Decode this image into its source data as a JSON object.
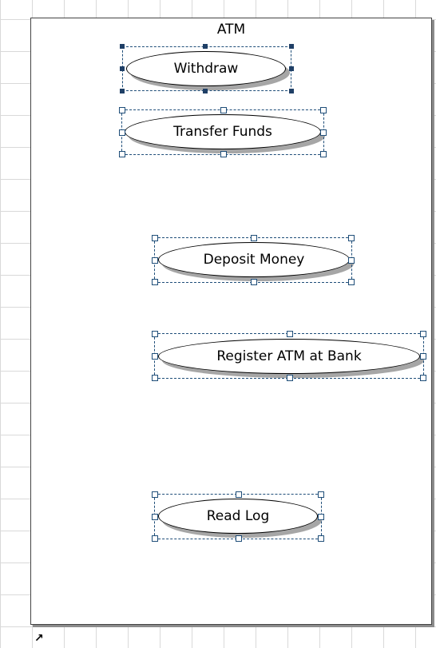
{
  "system": {
    "title": "ATM"
  },
  "use_cases": [
    {
      "label": "Withdraw"
    },
    {
      "label": "Transfer Funds"
    },
    {
      "label": "Deposit Money"
    },
    {
      "label": "Register ATM at Bank"
    },
    {
      "label": "Read Log"
    }
  ],
  "icons": {
    "resize_corner": "resize-corner-icon"
  },
  "colors": {
    "selection": "#1f4e79",
    "shadow": "#a6a6a6",
    "grid": "#d9d9d9"
  }
}
